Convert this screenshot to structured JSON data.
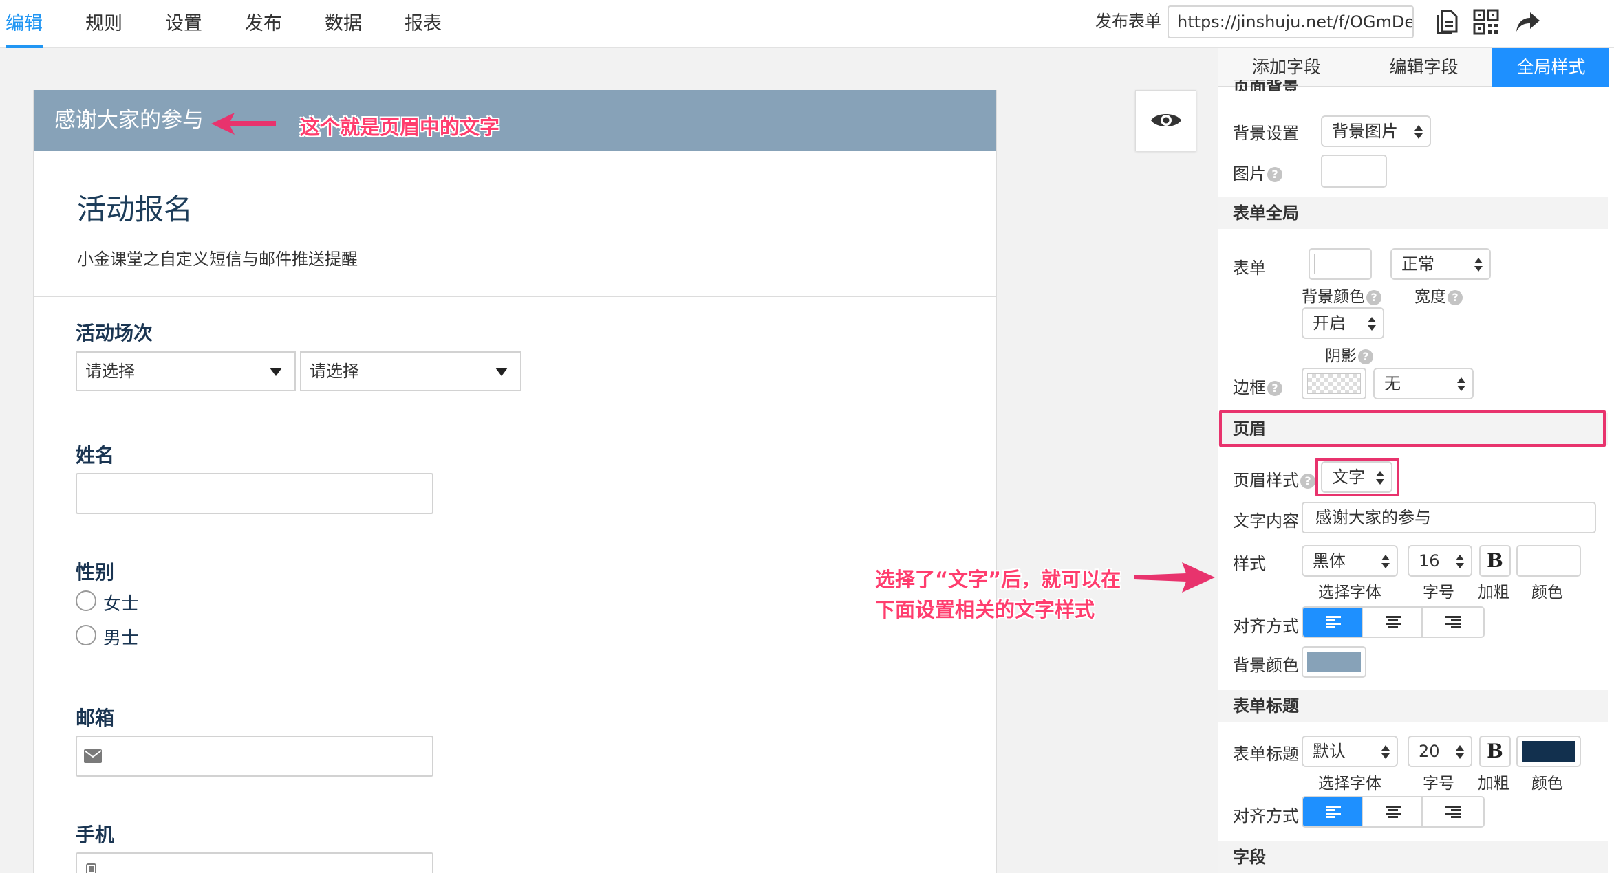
{
  "nav": {
    "tabs": [
      "编辑",
      "规则",
      "设置",
      "发布",
      "数据",
      "报表"
    ],
    "active_tab": "编辑",
    "publish_label": "发布表单",
    "url": "https://jinshuju.net/f/OGmDe",
    "tools": [
      "document-icon",
      "qrcode-icon",
      "share-icon"
    ]
  },
  "form": {
    "header_text": "感谢大家的参与",
    "header_bg": "#87a2b8",
    "title": "活动报名",
    "description": "小金课堂之自定义短信与邮件推送提醒",
    "fields": {
      "session": {
        "label": "活动场次",
        "select1": "请选择",
        "select2": "请选择"
      },
      "name": {
        "label": "姓名"
      },
      "gender": {
        "label": "性别",
        "options": [
          "女士",
          "男士"
        ]
      },
      "email": {
        "label": "邮箱"
      },
      "phone": {
        "label": "手机"
      }
    }
  },
  "panel": {
    "tabs": [
      "添加字段",
      "编辑字段",
      "全局样式"
    ],
    "active_tab": "全局样式",
    "page_bg": {
      "title_cut": "页面背景",
      "bg_setting_label": "背景设置",
      "bg_setting_value": "背景图片",
      "image_label": "图片"
    },
    "form_global": {
      "title": "表单全局",
      "form_label": "表单",
      "bg_color_label": "背景颜色",
      "width_value": "正常",
      "width_label": "宽度",
      "shadow_value": "开启",
      "shadow_label": "阴影",
      "border_label": "边框",
      "border_value": "无"
    },
    "header": {
      "title": "页眉",
      "style_label": "页眉样式",
      "style_value": "文字",
      "content_label": "文字内容",
      "content_value": "感谢大家的参与",
      "style_row_label": "样式",
      "font_value": "黑体",
      "font_caption": "选择字体",
      "size_value": "16",
      "size_caption": "字号",
      "bold_symbol": "B",
      "bold_caption": "加粗",
      "color_caption": "颜色",
      "align_label": "对齐方式",
      "bg_color_label": "背景颜色",
      "bg_color": "#87a2b8"
    },
    "form_title": {
      "title": "表单标题",
      "title_label": "表单标题",
      "font_value": "默认",
      "font_caption": "选择字体",
      "size_value": "20",
      "size_caption": "字号",
      "bold_symbol": "B",
      "bold_caption": "加粗",
      "color_caption": "颜色",
      "text_color": "#12304e",
      "align_label": "对齐方式"
    },
    "fields_section": {
      "title": "字段"
    }
  },
  "annotations": {
    "header_note": "这个就是页眉中的文字",
    "style_note_line1": "选择了“文字”后，就可以在",
    "style_note_line2": "下面设置相关的文字样式",
    "color": "#e8336d"
  }
}
